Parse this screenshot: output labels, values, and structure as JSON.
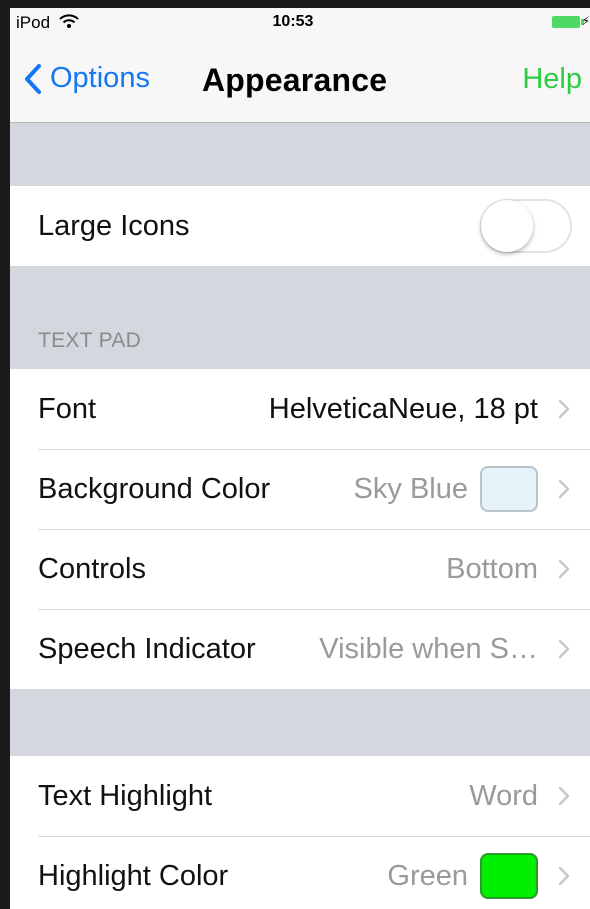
{
  "status_bar": {
    "device": "iPod",
    "time": "10:53"
  },
  "nav": {
    "back_label": "Options",
    "title": "Appearance",
    "help_label": "Help"
  },
  "general": {
    "large_icons_label": "Large Icons",
    "large_icons_on": false
  },
  "text_pad": {
    "header": "TEXT PAD",
    "font_label": "Font",
    "font_value": "HelveticaNeue, 18 pt",
    "background_color_label": "Background Color",
    "background_color_value": "Sky Blue",
    "background_color_hex": "#e6f2fa",
    "controls_label": "Controls",
    "controls_value": "Bottom",
    "speech_indicator_label": "Speech Indicator",
    "speech_indicator_value": "Visible when S…"
  },
  "highlight": {
    "text_highlight_label": "Text Highlight",
    "text_highlight_value": "Word",
    "highlight_color_label": "Highlight Color",
    "highlight_color_value": "Green",
    "highlight_color_hex": "#00f000"
  },
  "colors": {
    "accent_blue": "#1477f3",
    "help_green": "#2ecc40",
    "grouped_background": "#d4d7de",
    "battery_green": "#4cd964"
  },
  "icons": {
    "back": "chevron-left-icon",
    "disclosure": "chevron-right-icon",
    "wifi": "wifi-icon",
    "battery": "battery-icon",
    "charging": "charging-bolt-icon"
  }
}
